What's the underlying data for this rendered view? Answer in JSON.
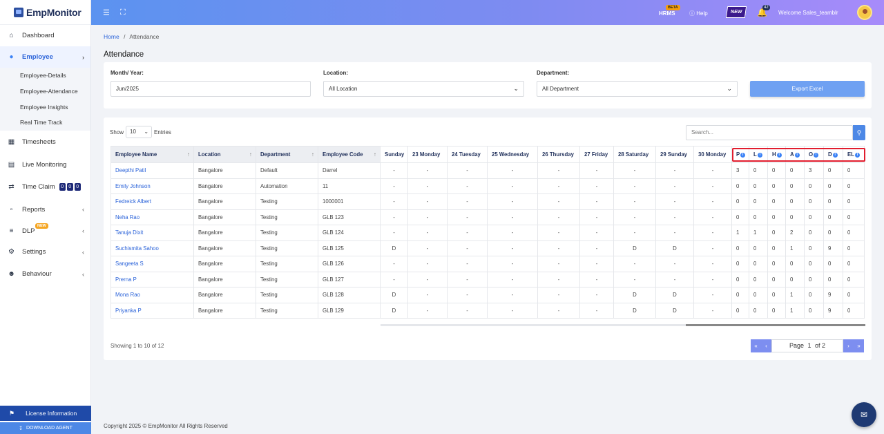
{
  "brand": {
    "name": "EmpMonitor"
  },
  "sidebar": {
    "items": [
      {
        "label": "Dashboard",
        "icon": "home-icon"
      },
      {
        "label": "Employee",
        "icon": "user-icon"
      },
      {
        "label": "Timesheets",
        "icon": "calendar-icon"
      },
      {
        "label": "Live Monitoring",
        "icon": "monitor-icon"
      },
      {
        "label": "Time Claim",
        "icon": "swap-icon"
      },
      {
        "label": "Reports",
        "icon": "report-icon"
      },
      {
        "label": "DLP",
        "icon": "sliders-icon"
      },
      {
        "label": "Settings",
        "icon": "gear-icon"
      },
      {
        "label": "Behaviour",
        "icon": "user-gear-icon"
      }
    ],
    "employee_sub": [
      "Employee-Details",
      "Employee-Attendance",
      "Employee Insights",
      "Real Time Track"
    ],
    "time_claim_counts": [
      "0",
      "0",
      "0"
    ],
    "dlp_badge": "NEW",
    "license": "License Information",
    "download": "DOWNLOAD AGENT"
  },
  "topbar": {
    "hrms": "HRMS",
    "beta": "BETA",
    "help": "Help",
    "new_flag": "NEW",
    "notifications": "42",
    "welcome": "Welcome Sales_teamblr"
  },
  "breadcrumb": {
    "home": "Home",
    "sep": "/",
    "current": "Attendance"
  },
  "page_title": "Attendance",
  "filters": {
    "month_label": "Month/ Year:",
    "month_value": "Jun/2025",
    "location_label": "Location:",
    "location_value": "All Location",
    "department_label": "Department:",
    "department_value": "All Department",
    "export": "Export Excel"
  },
  "table": {
    "show": "Show",
    "entries_value": "10",
    "entries": "Entries",
    "search_placeholder": "Search...",
    "headers": [
      "Employee Name",
      "Location",
      "Department",
      "Employee Code",
      "Sunday",
      "23 Monday",
      "24 Tuesday",
      "25 Wednesday",
      "26 Thursday",
      "27 Friday",
      "28 Saturday",
      "29 Sunday",
      "30 Monday",
      "P",
      "L",
      "H",
      "A",
      "O",
      "D",
      "EL"
    ],
    "rows": [
      [
        "Deepthi Patil",
        "Bangalore",
        "Default",
        "Darrel",
        "-",
        "-",
        "-",
        "-",
        "-",
        "-",
        "-",
        "-",
        "-",
        "3",
        "0",
        "0",
        "0",
        "3",
        "0",
        "0"
      ],
      [
        "Emily Johnson",
        "Bangalore",
        "Automation",
        "11",
        "-",
        "-",
        "-",
        "-",
        "-",
        "-",
        "-",
        "-",
        "-",
        "0",
        "0",
        "0",
        "0",
        "0",
        "0",
        "0"
      ],
      [
        "Fedreick Albert",
        "Bangalore",
        "Testing",
        "1000001",
        "-",
        "-",
        "-",
        "-",
        "-",
        "-",
        "-",
        "-",
        "-",
        "0",
        "0",
        "0",
        "0",
        "0",
        "0",
        "0"
      ],
      [
        "Neha Rao",
        "Bangalore",
        "Testing",
        "GLB 123",
        "-",
        "-",
        "-",
        "-",
        "-",
        "-",
        "-",
        "-",
        "-",
        "0",
        "0",
        "0",
        "0",
        "0",
        "0",
        "0"
      ],
      [
        "Tanuja Dixit",
        "Bangalore",
        "Testing",
        "GLB 124",
        "-",
        "-",
        "-",
        "-",
        "-",
        "-",
        "-",
        "-",
        "-",
        "1",
        "1",
        "0",
        "2",
        "0",
        "0",
        "0"
      ],
      [
        "Suchismita Sahoo",
        "Bangalore",
        "Testing",
        "GLB 125",
        "D",
        "-",
        "-",
        "-",
        "-",
        "-",
        "D",
        "D",
        "-",
        "0",
        "0",
        "0",
        "1",
        "0",
        "9",
        "0"
      ],
      [
        "Sangeeta S",
        "Bangalore",
        "Testing",
        "GLB 126",
        "-",
        "-",
        "-",
        "-",
        "-",
        "-",
        "-",
        "-",
        "-",
        "0",
        "0",
        "0",
        "0",
        "0",
        "0",
        "0"
      ],
      [
        "Prerna P",
        "Bangalore",
        "Testing",
        "GLB 127",
        "-",
        "-",
        "-",
        "-",
        "-",
        "-",
        "-",
        "-",
        "-",
        "0",
        "0",
        "0",
        "0",
        "0",
        "0",
        "0"
      ],
      [
        "Mona Rao",
        "Bangalore",
        "Testing",
        "GLB 128",
        "D",
        "-",
        "-",
        "-",
        "-",
        "-",
        "D",
        "D",
        "-",
        "0",
        "0",
        "0",
        "1",
        "0",
        "9",
        "0"
      ],
      [
        "Priyanka P",
        "Bangalore",
        "Testing",
        "GLB 129",
        "D",
        "-",
        "-",
        "-",
        "-",
        "-",
        "D",
        "D",
        "-",
        "0",
        "0",
        "0",
        "1",
        "0",
        "9",
        "0"
      ]
    ],
    "showing": "Showing 1 to 10 of 12",
    "page_label": "Page",
    "page_current": "1",
    "page_of": "of 2"
  },
  "footer": {
    "copyright": "Copyright 2025 © EmpMonitor All Rights Reserved"
  },
  "colors": {
    "accent": "#4d88e6",
    "highlight": "#e11d2e",
    "link": "#2b63d9"
  }
}
